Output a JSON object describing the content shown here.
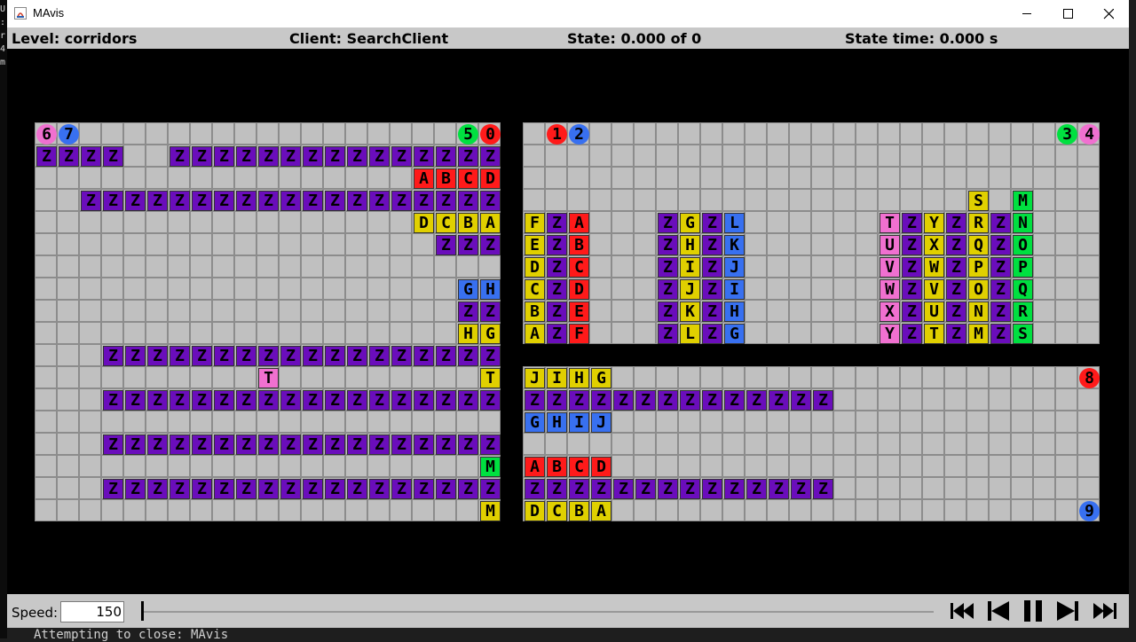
{
  "window": {
    "title": "MAvis",
    "icon": "java-app-icon",
    "controls": [
      "minimize-icon",
      "maximize-icon",
      "close-icon"
    ]
  },
  "status": {
    "level": "Level: corridors",
    "client": "Client: SearchClient",
    "state": "State: 0.000 of 0",
    "time": "State time: 0.000 s"
  },
  "colors": {
    "floor": "#c0c0c0",
    "gridline": "#8c8c8c",
    "wall": "#000000",
    "purple": "#6a0dbb",
    "red": "#ff1a1a",
    "yellow": "#e0d000",
    "blue": "#3870f0",
    "pink": "#f070d0",
    "green": "#00e040"
  },
  "map": {
    "rows": [
      "faa.......................ee.hgh.......................ii",
      "ppppw.pppppppppppppppp",
      "..................rrrr",
      "..pppppppppppppppppppp",
      ".................yyyy.",
      "..................ppp.",
      "......................",
      "..................bb..",
      "..................pp..",
      "..................yy..",
      "...ppppppppppppppppppp",
      "..........k.........y.",
      "...ppppppppppppppppppp",
      "......................",
      "...ppppppppppppppppppp",
      ".....................g",
      "...ppppppppppppppppppp",
      ".....................y"
    ],
    "left_cols": 21,
    "right_cols": 26,
    "left_boxes": [
      {
        "r": 1,
        "c": 0,
        "ch": "Z",
        "col": "purple"
      },
      {
        "r": 1,
        "c": 1,
        "ch": "Z",
        "col": "purple"
      },
      {
        "r": 1,
        "c": 2,
        "ch": "Z",
        "col": "purple"
      },
      {
        "r": 1,
        "c": 3,
        "ch": "Z",
        "col": "purple"
      },
      {
        "r": 1,
        "c": 6,
        "ch": "Z",
        "col": "purple"
      },
      {
        "r": 1,
        "c": 7,
        "ch": "Z",
        "col": "purple"
      },
      {
        "r": 1,
        "c": 8,
        "ch": "Z",
        "col": "purple"
      },
      {
        "r": 1,
        "c": 9,
        "ch": "Z",
        "col": "purple"
      },
      {
        "r": 1,
        "c": 10,
        "ch": "Z",
        "col": "purple"
      },
      {
        "r": 1,
        "c": 11,
        "ch": "Z",
        "col": "purple"
      },
      {
        "r": 1,
        "c": 12,
        "ch": "Z",
        "col": "purple"
      },
      {
        "r": 1,
        "c": 13,
        "ch": "Z",
        "col": "purple"
      },
      {
        "r": 1,
        "c": 14,
        "ch": "Z",
        "col": "purple"
      },
      {
        "r": 1,
        "c": 15,
        "ch": "Z",
        "col": "purple"
      },
      {
        "r": 1,
        "c": 16,
        "ch": "Z",
        "col": "purple"
      },
      {
        "r": 1,
        "c": 17,
        "ch": "Z",
        "col": "purple"
      },
      {
        "r": 1,
        "c": 18,
        "ch": "Z",
        "col": "purple"
      },
      {
        "r": 1,
        "c": 19,
        "ch": "Z",
        "col": "purple"
      },
      {
        "r": 1,
        "c": 20,
        "ch": "Z",
        "col": "purple"
      },
      {
        "r": 2,
        "c": 17,
        "ch": "A",
        "col": "red"
      },
      {
        "r": 2,
        "c": 18,
        "ch": "B",
        "col": "red"
      },
      {
        "r": 2,
        "c": 19,
        "ch": "C",
        "col": "red"
      },
      {
        "r": 2,
        "c": 20,
        "ch": "D",
        "col": "red"
      },
      {
        "r": 3,
        "c": 2,
        "ch": "Z",
        "col": "purple"
      },
      {
        "r": 3,
        "c": 3,
        "ch": "Z",
        "col": "purple"
      },
      {
        "r": 3,
        "c": 4,
        "ch": "Z",
        "col": "purple"
      },
      {
        "r": 3,
        "c": 5,
        "ch": "Z",
        "col": "purple"
      },
      {
        "r": 3,
        "c": 6,
        "ch": "Z",
        "col": "purple"
      },
      {
        "r": 3,
        "c": 7,
        "ch": "Z",
        "col": "purple"
      },
      {
        "r": 3,
        "c": 8,
        "ch": "Z",
        "col": "purple"
      },
      {
        "r": 3,
        "c": 9,
        "ch": "Z",
        "col": "purple"
      },
      {
        "r": 3,
        "c": 10,
        "ch": "Z",
        "col": "purple"
      },
      {
        "r": 3,
        "c": 11,
        "ch": "Z",
        "col": "purple"
      },
      {
        "r": 3,
        "c": 12,
        "ch": "Z",
        "col": "purple"
      },
      {
        "r": 3,
        "c": 13,
        "ch": "Z",
        "col": "purple"
      },
      {
        "r": 3,
        "c": 14,
        "ch": "Z",
        "col": "purple"
      },
      {
        "r": 3,
        "c": 15,
        "ch": "Z",
        "col": "purple"
      },
      {
        "r": 3,
        "c": 16,
        "ch": "Z",
        "col": "purple"
      },
      {
        "r": 3,
        "c": 17,
        "ch": "Z",
        "col": "purple"
      },
      {
        "r": 3,
        "c": 18,
        "ch": "Z",
        "col": "purple"
      },
      {
        "r": 3,
        "c": 19,
        "ch": "Z",
        "col": "purple"
      },
      {
        "r": 3,
        "c": 20,
        "ch": "Z",
        "col": "purple"
      },
      {
        "r": 4,
        "c": 17,
        "ch": "D",
        "col": "yellow"
      },
      {
        "r": 4,
        "c": 18,
        "ch": "C",
        "col": "yellow"
      },
      {
        "r": 4,
        "c": 19,
        "ch": "B",
        "col": "yellow"
      },
      {
        "r": 4,
        "c": 20,
        "ch": "A",
        "col": "yellow"
      },
      {
        "r": 5,
        "c": 18,
        "ch": "Z",
        "col": "purple"
      },
      {
        "r": 5,
        "c": 19,
        "ch": "Z",
        "col": "purple"
      },
      {
        "r": 5,
        "c": 20,
        "ch": "Z",
        "col": "purple"
      },
      {
        "r": 7,
        "c": 19,
        "ch": "G",
        "col": "blue"
      },
      {
        "r": 7,
        "c": 20,
        "ch": "H",
        "col": "blue"
      },
      {
        "r": 8,
        "c": 19,
        "ch": "Z",
        "col": "purple"
      },
      {
        "r": 8,
        "c": 20,
        "ch": "Z",
        "col": "purple"
      },
      {
        "r": 9,
        "c": 19,
        "ch": "H",
        "col": "yellow"
      },
      {
        "r": 9,
        "c": 20,
        "ch": "G",
        "col": "yellow"
      },
      {
        "r": 11,
        "c": 10,
        "ch": "T",
        "col": "pink"
      },
      {
        "r": 11,
        "c": 20,
        "ch": "T",
        "col": "yellow"
      },
      {
        "r": 15,
        "c": 20,
        "ch": "M",
        "col": "green"
      },
      {
        "r": 17,
        "c": 20,
        "ch": "M",
        "col": "yellow"
      }
    ],
    "left_rows_purple": [
      10,
      12,
      14,
      16
    ],
    "right_boxes": [
      {
        "r": 3,
        "c": 20,
        "ch": "S",
        "col": "yellow"
      },
      {
        "r": 3,
        "c": 22,
        "ch": "M",
        "col": "green"
      },
      {
        "r": 4,
        "c": 0,
        "ch": "F",
        "col": "yellow"
      },
      {
        "r": 4,
        "c": 1,
        "ch": "Z",
        "col": "purple"
      },
      {
        "r": 4,
        "c": 2,
        "ch": "A",
        "col": "red"
      },
      {
        "r": 5,
        "c": 0,
        "ch": "E",
        "col": "yellow"
      },
      {
        "r": 5,
        "c": 1,
        "ch": "Z",
        "col": "purple"
      },
      {
        "r": 5,
        "c": 2,
        "ch": "B",
        "col": "red"
      },
      {
        "r": 6,
        "c": 0,
        "ch": "D",
        "col": "yellow"
      },
      {
        "r": 6,
        "c": 1,
        "ch": "Z",
        "col": "purple"
      },
      {
        "r": 6,
        "c": 2,
        "ch": "C",
        "col": "red"
      },
      {
        "r": 7,
        "c": 0,
        "ch": "C",
        "col": "yellow"
      },
      {
        "r": 7,
        "c": 1,
        "ch": "Z",
        "col": "purple"
      },
      {
        "r": 7,
        "c": 2,
        "ch": "D",
        "col": "red"
      },
      {
        "r": 8,
        "c": 0,
        "ch": "B",
        "col": "yellow"
      },
      {
        "r": 8,
        "c": 1,
        "ch": "Z",
        "col": "purple"
      },
      {
        "r": 8,
        "c": 2,
        "ch": "E",
        "col": "red"
      },
      {
        "r": 9,
        "c": 0,
        "ch": "A",
        "col": "yellow"
      },
      {
        "r": 9,
        "c": 1,
        "ch": "Z",
        "col": "purple"
      },
      {
        "r": 9,
        "c": 2,
        "ch": "F",
        "col": "red"
      },
      {
        "r": 4,
        "c": 6,
        "ch": "Z",
        "col": "purple"
      },
      {
        "r": 4,
        "c": 7,
        "ch": "G",
        "col": "yellow"
      },
      {
        "r": 4,
        "c": 8,
        "ch": "Z",
        "col": "purple"
      },
      {
        "r": 4,
        "c": 9,
        "ch": "L",
        "col": "blue"
      },
      {
        "r": 5,
        "c": 6,
        "ch": "Z",
        "col": "purple"
      },
      {
        "r": 5,
        "c": 7,
        "ch": "H",
        "col": "yellow"
      },
      {
        "r": 5,
        "c": 8,
        "ch": "Z",
        "col": "purple"
      },
      {
        "r": 5,
        "c": 9,
        "ch": "K",
        "col": "blue"
      },
      {
        "r": 6,
        "c": 6,
        "ch": "Z",
        "col": "purple"
      },
      {
        "r": 6,
        "c": 7,
        "ch": "I",
        "col": "yellow"
      },
      {
        "r": 6,
        "c": 8,
        "ch": "Z",
        "col": "purple"
      },
      {
        "r": 6,
        "c": 9,
        "ch": "J",
        "col": "blue"
      },
      {
        "r": 7,
        "c": 6,
        "ch": "Z",
        "col": "purple"
      },
      {
        "r": 7,
        "c": 7,
        "ch": "J",
        "col": "yellow"
      },
      {
        "r": 7,
        "c": 8,
        "ch": "Z",
        "col": "purple"
      },
      {
        "r": 7,
        "c": 9,
        "ch": "I",
        "col": "blue"
      },
      {
        "r": 8,
        "c": 6,
        "ch": "Z",
        "col": "purple"
      },
      {
        "r": 8,
        "c": 7,
        "ch": "K",
        "col": "yellow"
      },
      {
        "r": 8,
        "c": 8,
        "ch": "Z",
        "col": "purple"
      },
      {
        "r": 8,
        "c": 9,
        "ch": "H",
        "col": "blue"
      },
      {
        "r": 9,
        "c": 6,
        "ch": "Z",
        "col": "purple"
      },
      {
        "r": 9,
        "c": 7,
        "ch": "L",
        "col": "yellow"
      },
      {
        "r": 9,
        "c": 8,
        "ch": "Z",
        "col": "purple"
      },
      {
        "r": 9,
        "c": 9,
        "ch": "G",
        "col": "blue"
      },
      {
        "r": 4,
        "c": 16,
        "ch": "T",
        "col": "pink"
      },
      {
        "r": 4,
        "c": 17,
        "ch": "Z",
        "col": "purple"
      },
      {
        "r": 4,
        "c": 18,
        "ch": "Y",
        "col": "yellow"
      },
      {
        "r": 4,
        "c": 19,
        "ch": "Z",
        "col": "purple"
      },
      {
        "r": 4,
        "c": 20,
        "ch": "R",
        "col": "yellow"
      },
      {
        "r": 4,
        "c": 21,
        "ch": "Z",
        "col": "purple"
      },
      {
        "r": 4,
        "c": 22,
        "ch": "N",
        "col": "green"
      },
      {
        "r": 5,
        "c": 16,
        "ch": "U",
        "col": "pink"
      },
      {
        "r": 5,
        "c": 17,
        "ch": "Z",
        "col": "purple"
      },
      {
        "r": 5,
        "c": 18,
        "ch": "X",
        "col": "yellow"
      },
      {
        "r": 5,
        "c": 19,
        "ch": "Z",
        "col": "purple"
      },
      {
        "r": 5,
        "c": 20,
        "ch": "Q",
        "col": "yellow"
      },
      {
        "r": 5,
        "c": 21,
        "ch": "Z",
        "col": "purple"
      },
      {
        "r": 5,
        "c": 22,
        "ch": "O",
        "col": "green"
      },
      {
        "r": 6,
        "c": 16,
        "ch": "V",
        "col": "pink"
      },
      {
        "r": 6,
        "c": 17,
        "ch": "Z",
        "col": "purple"
      },
      {
        "r": 6,
        "c": 18,
        "ch": "W",
        "col": "yellow"
      },
      {
        "r": 6,
        "c": 19,
        "ch": "Z",
        "col": "purple"
      },
      {
        "r": 6,
        "c": 20,
        "ch": "P",
        "col": "yellow"
      },
      {
        "r": 6,
        "c": 21,
        "ch": "Z",
        "col": "purple"
      },
      {
        "r": 6,
        "c": 22,
        "ch": "P",
        "col": "green"
      },
      {
        "r": 7,
        "c": 16,
        "ch": "W",
        "col": "pink"
      },
      {
        "r": 7,
        "c": 17,
        "ch": "Z",
        "col": "purple"
      },
      {
        "r": 7,
        "c": 18,
        "ch": "V",
        "col": "yellow"
      },
      {
        "r": 7,
        "c": 19,
        "ch": "Z",
        "col": "purple"
      },
      {
        "r": 7,
        "c": 20,
        "ch": "O",
        "col": "yellow"
      },
      {
        "r": 7,
        "c": 21,
        "ch": "Z",
        "col": "purple"
      },
      {
        "r": 7,
        "c": 22,
        "ch": "Q",
        "col": "green"
      },
      {
        "r": 8,
        "c": 16,
        "ch": "X",
        "col": "pink"
      },
      {
        "r": 8,
        "c": 17,
        "ch": "Z",
        "col": "purple"
      },
      {
        "r": 8,
        "c": 18,
        "ch": "U",
        "col": "yellow"
      },
      {
        "r": 8,
        "c": 19,
        "ch": "Z",
        "col": "purple"
      },
      {
        "r": 8,
        "c": 20,
        "ch": "N",
        "col": "yellow"
      },
      {
        "r": 8,
        "c": 21,
        "ch": "Z",
        "col": "purple"
      },
      {
        "r": 8,
        "c": 22,
        "ch": "R",
        "col": "green"
      },
      {
        "r": 9,
        "c": 16,
        "ch": "Y",
        "col": "pink"
      },
      {
        "r": 9,
        "c": 17,
        "ch": "Z",
        "col": "purple"
      },
      {
        "r": 9,
        "c": 18,
        "ch": "T",
        "col": "yellow"
      },
      {
        "r": 9,
        "c": 19,
        "ch": "Z",
        "col": "purple"
      },
      {
        "r": 9,
        "c": 20,
        "ch": "M",
        "col": "yellow"
      },
      {
        "r": 9,
        "c": 21,
        "ch": "Z",
        "col": "purple"
      },
      {
        "r": 9,
        "c": 22,
        "ch": "S",
        "col": "green"
      },
      {
        "r": 11,
        "c": 0,
        "ch": "J",
        "col": "yellow"
      },
      {
        "r": 11,
        "c": 1,
        "ch": "I",
        "col": "yellow"
      },
      {
        "r": 11,
        "c": 2,
        "ch": "H",
        "col": "yellow"
      },
      {
        "r": 11,
        "c": 3,
        "ch": "G",
        "col": "yellow"
      },
      {
        "r": 13,
        "c": 0,
        "ch": "G",
        "col": "blue"
      },
      {
        "r": 13,
        "c": 1,
        "ch": "H",
        "col": "blue"
      },
      {
        "r": 13,
        "c": 2,
        "ch": "I",
        "col": "blue"
      },
      {
        "r": 13,
        "c": 3,
        "ch": "J",
        "col": "blue"
      },
      {
        "r": 15,
        "c": 0,
        "ch": "A",
        "col": "red"
      },
      {
        "r": 15,
        "c": 1,
        "ch": "B",
        "col": "red"
      },
      {
        "r": 15,
        "c": 2,
        "ch": "C",
        "col": "red"
      },
      {
        "r": 15,
        "c": 3,
        "ch": "D",
        "col": "red"
      },
      {
        "r": 17,
        "c": 0,
        "ch": "D",
        "col": "yellow"
      },
      {
        "r": 17,
        "c": 1,
        "ch": "C",
        "col": "yellow"
      },
      {
        "r": 17,
        "c": 2,
        "ch": "B",
        "col": "yellow"
      },
      {
        "r": 17,
        "c": 3,
        "ch": "A",
        "col": "yellow"
      }
    ],
    "right_rows_purple": [
      12,
      16
    ],
    "right_purple_len": 14,
    "right_wall_row": 10,
    "agents": [
      {
        "side": "left",
        "r": 0,
        "c": 0,
        "ch": "6",
        "col": "pink"
      },
      {
        "side": "left",
        "r": 0,
        "c": 1,
        "ch": "7",
        "col": "blue"
      },
      {
        "side": "left",
        "r": 0,
        "c": 19,
        "ch": "5",
        "col": "green"
      },
      {
        "side": "left",
        "r": 0,
        "c": 20,
        "ch": "0",
        "col": "red"
      },
      {
        "side": "right",
        "r": 0,
        "c": 1,
        "ch": "1",
        "col": "red"
      },
      {
        "side": "right",
        "r": 0,
        "c": 2,
        "ch": "2",
        "col": "blue"
      },
      {
        "side": "right",
        "r": 0,
        "c": 24,
        "ch": "3",
        "col": "green"
      },
      {
        "side": "right",
        "r": 0,
        "c": 25,
        "ch": "4",
        "col": "pink"
      },
      {
        "side": "right",
        "r": 11,
        "c": 25,
        "ch": "8",
        "col": "red"
      },
      {
        "side": "right",
        "r": 17,
        "c": 25,
        "ch": "9",
        "col": "blue"
      }
    ]
  },
  "controls": {
    "speed_label": "Speed:",
    "speed_value": "150",
    "slider_position": 0,
    "buttons": [
      "skip-to-start-icon",
      "step-back-icon",
      "pause-icon",
      "step-forward-icon",
      "skip-to-end-icon"
    ]
  },
  "console": {
    "left_chars": [
      "U",
      ":",
      "r",
      "4",
      "m"
    ],
    "bottom_line": "Attempting to close: MAvis"
  }
}
